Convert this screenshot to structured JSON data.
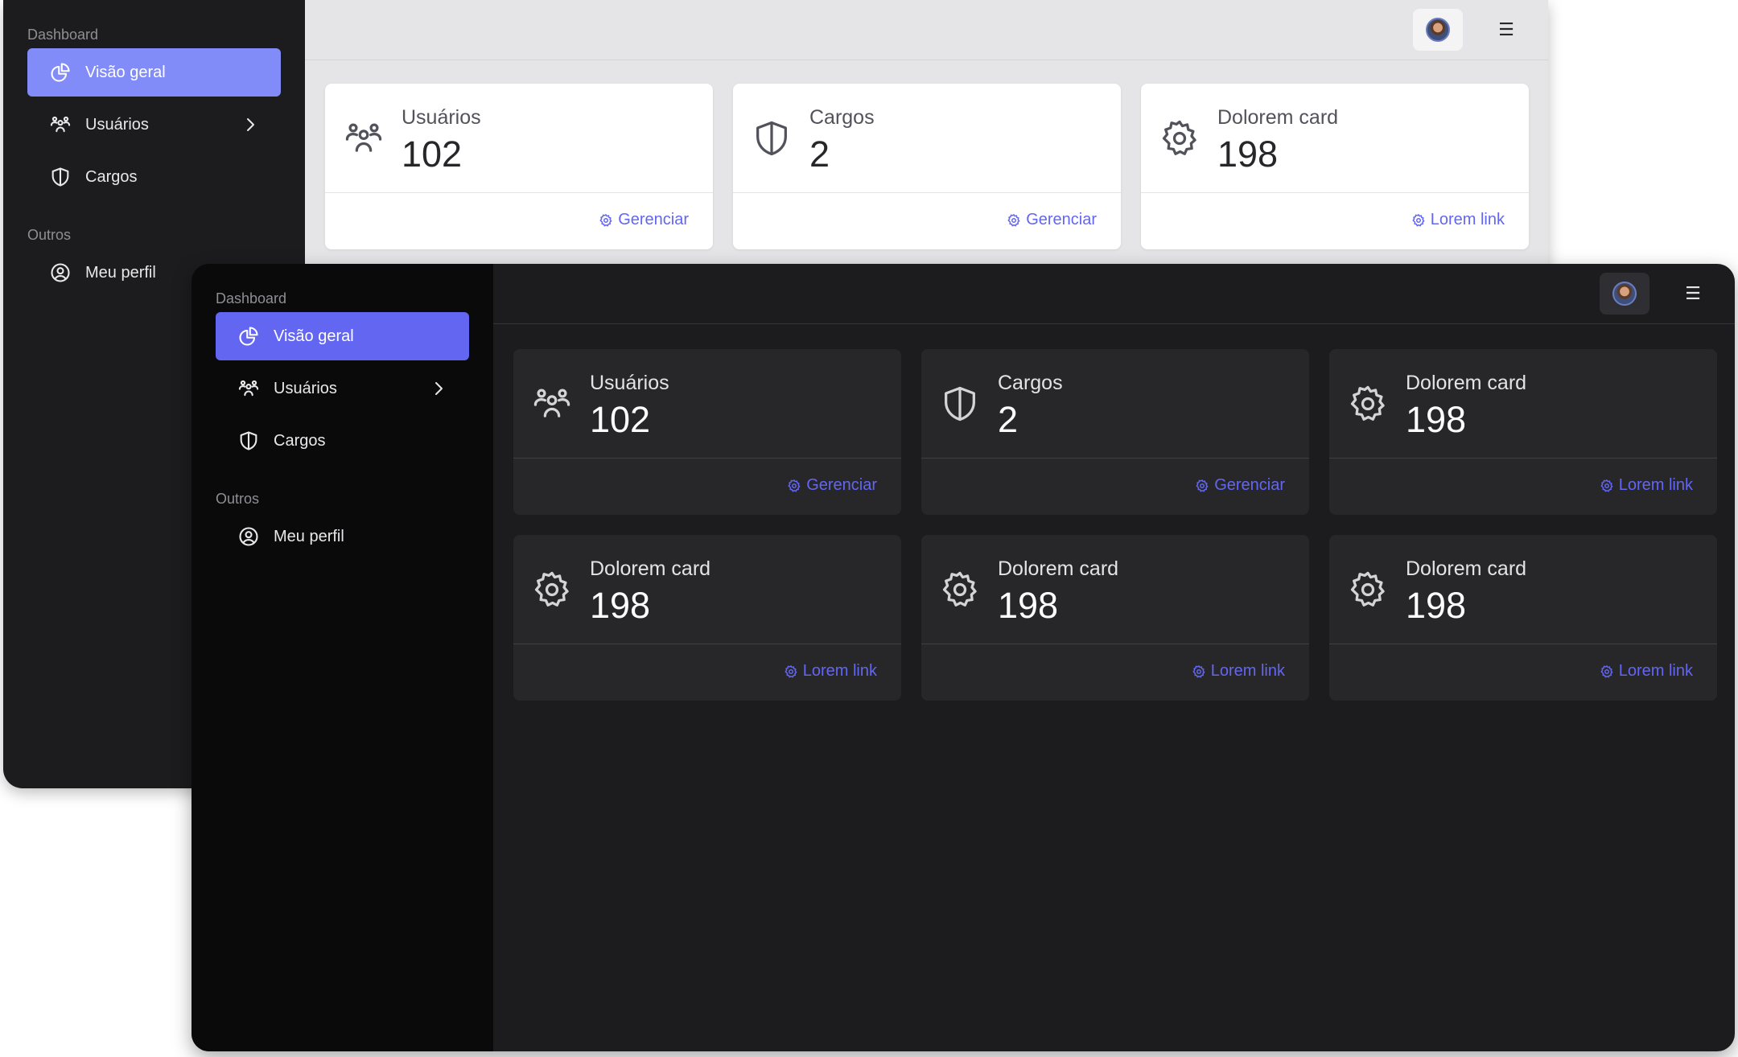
{
  "sidebar": {
    "section_dashboard": "Dashboard",
    "section_others": "Outros",
    "items": [
      {
        "label": "Visão geral",
        "icon": "chart-pie-icon"
      },
      {
        "label": "Usuários",
        "icon": "users-icon"
      },
      {
        "label": "Cargos",
        "icon": "shield-icon"
      },
      {
        "label": "Meu perfil",
        "icon": "user-circle-icon"
      }
    ]
  },
  "topbar": {
    "menu_glyph": "☰"
  },
  "cards": [
    {
      "title": "Usuários",
      "value": "102",
      "link": "Gerenciar",
      "icon": "users-icon"
    },
    {
      "title": "Cargos",
      "value": "2",
      "link": "Gerenciar",
      "icon": "shield-icon"
    },
    {
      "title": "Dolorem card",
      "value": "198",
      "link": "Lorem link",
      "icon": "cog-icon"
    },
    {
      "title": "Dolorem card",
      "value": "198",
      "link": "Lorem link",
      "icon": "cog-icon"
    },
    {
      "title": "Dolorem card",
      "value": "198",
      "link": "Lorem link",
      "icon": "cog-icon"
    },
    {
      "title": "Dolorem card",
      "value": "198",
      "link": "Lorem link",
      "icon": "cog-icon"
    }
  ],
  "theme": {
    "accent_light": "#818cf8",
    "accent_dark": "#6366f1"
  }
}
